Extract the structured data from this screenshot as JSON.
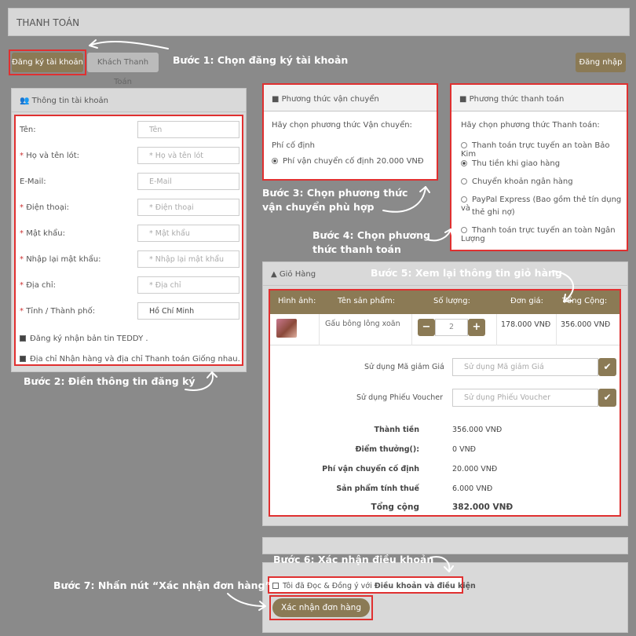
{
  "header": {
    "title": "THANH TOÁN"
  },
  "tabs": {
    "register": "Đăng ký tài khoản",
    "guest": "Khách Thanh Toán"
  },
  "login_button": "Đăng nhập",
  "account": {
    "title": "Thông tin tài khoản",
    "fields": [
      {
        "label": "Tên:",
        "required": false,
        "placeholder": "Tên",
        "value": ""
      },
      {
        "label": "Họ và tên lót:",
        "required": true,
        "placeholder": "* Họ và tên lót",
        "value": ""
      },
      {
        "label": "E-Mail:",
        "required": false,
        "placeholder": "E-Mail",
        "value": ""
      },
      {
        "label": "Điện thoại:",
        "required": true,
        "placeholder": "* Điện thoại",
        "value": ""
      },
      {
        "label": "Mật khẩu:",
        "required": true,
        "placeholder": "* Mật khẩu",
        "value": ""
      },
      {
        "label": "Nhập lại mật khẩu:",
        "required": true,
        "placeholder": "* Nhập lại mật khẩu",
        "value": ""
      },
      {
        "label": "Địa chỉ:",
        "required": true,
        "placeholder": "* Địa chỉ",
        "value": ""
      },
      {
        "label": "Tỉnh / Thành phố:",
        "required": true,
        "placeholder": "",
        "value": "Hồ Chí Minh"
      }
    ],
    "newsletter": "Đăng ký nhận bản tin TEDDY .",
    "same_address": "Địa chỉ Nhận hàng và địa chỉ Thanh toán Giống nhau."
  },
  "shipping": {
    "title": "Phương thức vận chuyển",
    "prompt": "Hãy chọn phương thức Vận chuyển:",
    "group": "Phí cố định",
    "option": "Phí vận chuyển cố định 20.000 VNĐ"
  },
  "payment": {
    "title": "Phương thức thanh toán",
    "prompt": "Hãy chọn phương thức Thanh toán:",
    "options": [
      {
        "label": "Thanh toán trực tuyến an toàn Bảo Kim",
        "selected": false
      },
      {
        "label": "Thu tiền khi giao hàng",
        "selected": true
      },
      {
        "label": "Chuyển khoản ngân hàng",
        "selected": false
      },
      {
        "label": "PayPal Express (Bao gồm thẻ tín dụng và",
        "selected": false
      },
      {
        "label": "Thanh toán trực tuyến an toàn Ngân Lượng",
        "selected": false
      }
    ],
    "paypal_line2": "thẻ ghi nợ)"
  },
  "cart": {
    "title": "Giỏ Hàng",
    "headers": {
      "image": "Hình ảnh:",
      "name": "Tên sản phẩm:",
      "qty": "Số lượng:",
      "price": "Đơn giá:",
      "total": "Tổng Cộng:"
    },
    "item": {
      "name": "Gấu bông lông xoăn",
      "qty": "2",
      "price": "178.000 VNĐ",
      "total": "356.000 VNĐ"
    },
    "coupon": {
      "label": "Sử dụng Mã giảm Giá",
      "placeholder": "Sử dụng Mã giảm Giá"
    },
    "voucher": {
      "label": "Sử dụng Phiếu Voucher",
      "placeholder": "Sử dụng Phiếu Voucher"
    },
    "summary": [
      {
        "label": "Thành tiền",
        "value": "356.000 VNĐ"
      },
      {
        "label": "Điểm thưởng():",
        "value": "0 VNĐ"
      },
      {
        "label": "Phí vận chuyển cố định",
        "value": "20.000 VNĐ"
      },
      {
        "label": "Sản phẩm tính thuế",
        "value": "6.000 VNĐ"
      }
    ],
    "grand_total": {
      "label": "Tổng cộng",
      "value": "382.000 VNĐ"
    }
  },
  "terms": {
    "text": "Tôi đã Đọc & Đồng ý với ",
    "link": "Điều khoản và điều kiện"
  },
  "confirm_button": "Xác nhận đơn hàng",
  "annotations": {
    "step1": "Bước 1: Chọn đăng ký tài khoản",
    "step2": "Bước 2: Điền thông tin đăng ký",
    "step3a": "Bước 3: Chọn phương thức",
    "step3b": "vận chuyển phù hợp",
    "step4a": "Bước 4: Chọn phương",
    "step4b": "thức thanh toán",
    "step5": "Bước 5: Xem lại thông tin giỏ hàng",
    "step6": "Bước 6: Xác nhận điều khoản",
    "step7": "Bước 7: Nhấn nút “Xác nhận đơn hàng”"
  },
  "colors": {
    "brand": "#8b7a55",
    "highlight": "#e03030"
  }
}
